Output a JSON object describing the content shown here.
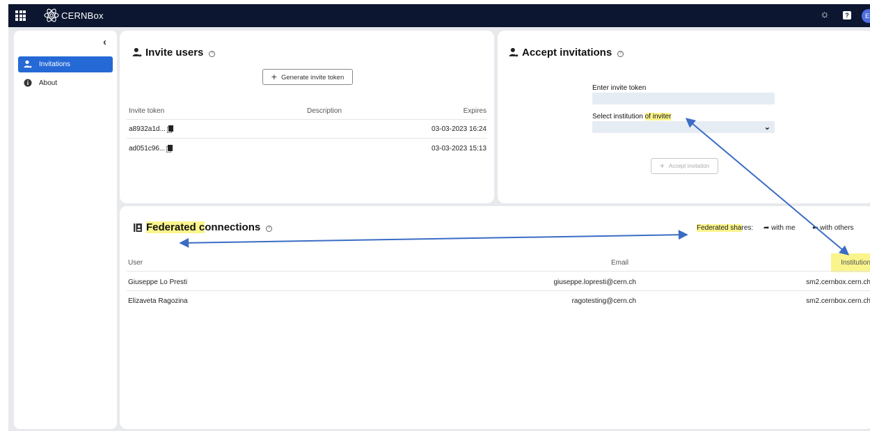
{
  "app": {
    "brand_prefix": "CERN",
    "brand_suffix": "Box",
    "avatar_initial": "E"
  },
  "sidebar": {
    "items": [
      {
        "label": "Invitations",
        "icon": "user-plus-icon",
        "active": true
      },
      {
        "label": "About",
        "icon": "info-icon",
        "active": false
      }
    ]
  },
  "invite_users": {
    "title": "Invite users",
    "generate_button": "Generate invite token",
    "columns": [
      "Invite token",
      "Description",
      "Expires"
    ],
    "rows": [
      {
        "token": "a8932a1d...",
        "description": "",
        "expires": "03-03-2023 16:24"
      },
      {
        "token": "ad051c96...",
        "description": "",
        "expires": "03-03-2023 15:13"
      }
    ]
  },
  "accept_invitations": {
    "title": "Accept invitations",
    "token_label": "Enter invite token",
    "token_value": "",
    "institution_label_a": "Select institution ",
    "institution_label_b": "of inviter",
    "institution_value": "",
    "accept_button": "Accept invitation"
  },
  "federated": {
    "title_a": "Federated c",
    "title_b": "onnections",
    "shares_label_a": "Federated sha",
    "shares_label_b": "res:",
    "with_me": "with me",
    "with_others": "with others",
    "columns": [
      "User",
      "Email",
      "Institution"
    ],
    "rows": [
      {
        "user": "Giuseppe Lo Presti",
        "email": "giuseppe.lopresti@cern.ch",
        "institution": "sm2.cernbox.cern.ch"
      },
      {
        "user": "Elizaveta Ragozina",
        "email": "ragotesting@cern.ch",
        "institution": "sm2.cernbox.cern.ch"
      }
    ]
  },
  "annotation": {
    "highlight_color": "#faf48c",
    "arrow_color": "#3a6cc4"
  }
}
